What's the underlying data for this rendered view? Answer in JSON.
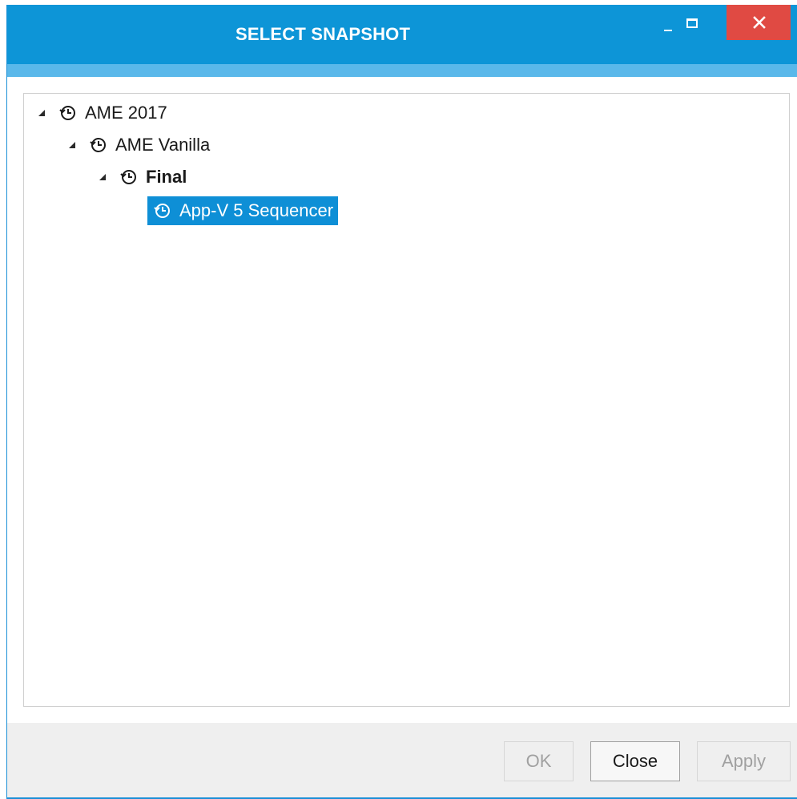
{
  "window": {
    "title": "SELECT SNAPSHOT",
    "colors": {
      "titlebar": "#0d95d7",
      "accent": "#5ab8ea",
      "close": "#e04a43",
      "selection": "#0e8fd6"
    }
  },
  "icons": {
    "node_icon": "history-clock-icon",
    "expand": "expanded-triangle-icon"
  },
  "tree": {
    "nodes": [
      {
        "label": "AME 2017",
        "level": 0,
        "expanded": true
      },
      {
        "label": "AME Vanilla",
        "level": 1,
        "expanded": true
      },
      {
        "label": "Final",
        "level": 2,
        "expanded": true,
        "bold": true
      },
      {
        "label": "App-V 5 Sequencer",
        "level": 3,
        "selected": true
      }
    ]
  },
  "footer": {
    "ok_label": "OK",
    "close_label": "Close",
    "apply_label": "Apply"
  }
}
